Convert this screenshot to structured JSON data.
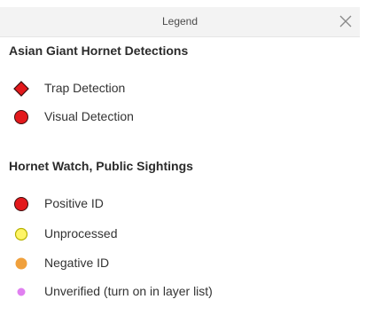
{
  "header": {
    "title": "Legend"
  },
  "sections": [
    {
      "title": "Asian Giant Hornet Detections",
      "items": [
        {
          "label": "Trap Detection",
          "symbol": "diamond",
          "fill": "#e3191c",
          "stroke": "#3a0d0d"
        },
        {
          "label": "Visual Detection",
          "symbol": "circle",
          "fill": "#e3191c",
          "stroke": "#3a0d0d"
        }
      ]
    },
    {
      "title": "Hornet Watch, Public Sightings",
      "items": [
        {
          "label": "Positive ID",
          "symbol": "circle",
          "fill": "#e3191c",
          "stroke": "#3a0d0d"
        },
        {
          "label": "Unprocessed",
          "symbol": "circle",
          "fill": "#fff566",
          "stroke": "#b7b200"
        },
        {
          "label": "Negative ID",
          "symbol": "circle",
          "fill": "#f0a03c",
          "stroke": "#f0a03c"
        },
        {
          "label": "Unverified (turn on in layer list)",
          "symbol": "circle-small",
          "fill": "#e080f0",
          "stroke": "#e080f0"
        }
      ]
    }
  ]
}
